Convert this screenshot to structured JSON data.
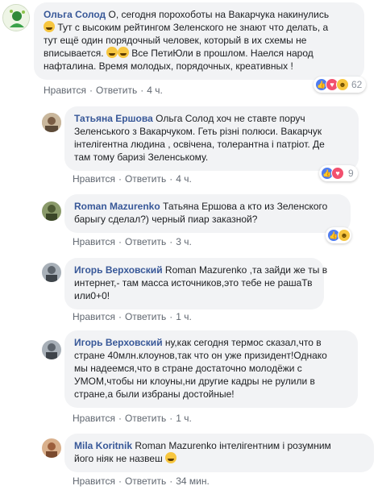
{
  "colors": {
    "author": "#385898",
    "bubble": "#f2f3f5",
    "muted": "#606770",
    "like": "#4f7cf0",
    "love": "#f2506e",
    "haha": "#f7c640"
  },
  "comments": [
    {
      "author": "Ольга Солод",
      "lines": [
        "О, сегодня порохоботы на Вакарчука накинулись",
        "Тут с высоким рейтингом Зеленского не знают что делать, а",
        "тут ещё один порядочный человек, который в их схемы не",
        "вписывается.",
        "Все ПетиЮли в прошлом. Наелся народ",
        "нафталина. Время молодых, порядочных, креативных !"
      ],
      "like": "Нравится",
      "reply": "Ответить",
      "time": "4 ч.",
      "reactions_count": "62",
      "reaction_icons": [
        "like-icon",
        "love-icon",
        "haha-icon"
      ]
    },
    {
      "author": "Татьяна Ершова",
      "lines": [
        "Ольга Солод хоч не ставте поруч",
        "Зеленського з Вакарчуком. Геть різні полюси. Вакарчук",
        "інтелігентна людина , освічена, толерантна і патріот. Де",
        "там тому баризі Зеленському."
      ],
      "like": "Нравится",
      "reply": "Ответить",
      "time": "4 ч.",
      "reactions_count": "9",
      "reaction_icons": [
        "like-icon",
        "love-icon"
      ]
    },
    {
      "author": "Roman Mazurenko",
      "lines": [
        "Татьяна Ершова а кто из Зеленского",
        "барыгу сделал?) черный пиар заказной?"
      ],
      "like": "Нравится",
      "reply": "Ответить",
      "time": "3 ч.",
      "reactions_count": "",
      "reaction_icons": [
        "like-icon",
        "haha-icon"
      ]
    },
    {
      "author": "Игорь Верховский",
      "lines": [
        "Roman Mazurenko ,та зайди же ты в",
        "интернет,- там масса источников,это тебе не рашаТв",
        "или0+0!"
      ],
      "like": "Нравится",
      "reply": "Ответить",
      "time": "1 ч."
    },
    {
      "author": "Игорь Верховский",
      "lines": [
        "ну,как сегодня термос сказал,что в",
        "стране 40млн.клоунов,так что он уже призидент!Однако",
        "мы надеемся,что в стране достаточно молодёжи с",
        "УМОМ,чтобы ни клоуны,ни другие кадры не рулили в",
        "стране,а были избраны достойные!"
      ],
      "like": "Нравится",
      "reply": "Ответить",
      "time": "1 ч."
    },
    {
      "author": "Mila Koritnik",
      "lines": [
        "Roman Mazurenko інтелігентним і розумним",
        "його ніяк не назвеш"
      ],
      "like": "Нравится",
      "reply": "Ответить",
      "time": "34 мин."
    }
  ]
}
